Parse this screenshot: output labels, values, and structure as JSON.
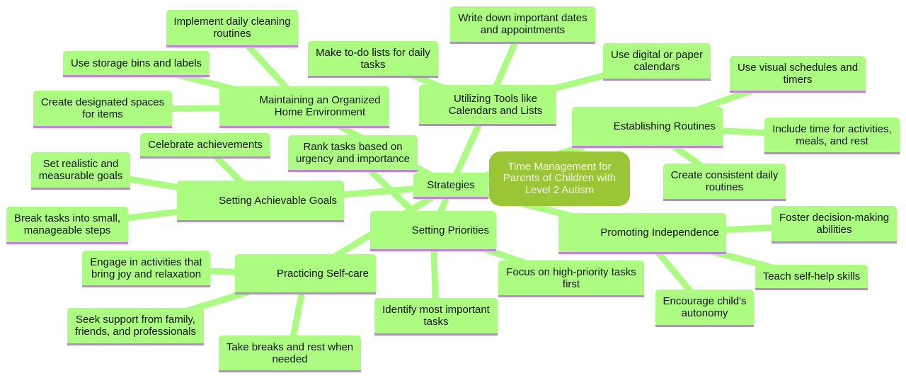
{
  "root": {
    "label": "Time Management for Parents of Children with Level 2 Autism"
  },
  "hub": {
    "label": "Strategies"
  },
  "colors": {
    "root_fill": "#9ac534",
    "node_fill": "#abfc80",
    "node_underline": "#c77fe8",
    "edge": "#a9fc80"
  },
  "branches": [
    {
      "label": "Maintaining an Organized Home Environment",
      "children": [
        "Implement daily cleaning routines",
        "Use storage bins and labels",
        "Create designated spaces for items"
      ]
    },
    {
      "label": "Utilizing Tools like Calendars and Lists",
      "children": [
        "Write down important dates and appointments",
        "Make to-do lists for daily tasks",
        "Use digital or paper calendars"
      ]
    },
    {
      "label": "Establishing Routines",
      "children": [
        "Use visual schedules and timers",
        "Include time for activities, meals, and rest",
        "Create consistent daily routines"
      ]
    },
    {
      "label": "Setting Achievable Goals",
      "children": [
        "Celebrate achievements",
        "Set realistic and measurable goals",
        "Break tasks into small, manageable steps"
      ]
    },
    {
      "label": "Setting Priorities",
      "children": [
        "Rank tasks based on urgency and importance",
        "Focus on high-priority tasks first",
        "Identify most important tasks"
      ]
    },
    {
      "label": "Practicing Self-care",
      "children": [
        "Engage in activities that bring joy and relaxation",
        "Seek support from family, friends, and professionals",
        "Take breaks and rest when needed"
      ]
    },
    {
      "label": "Promoting Independence",
      "children": [
        "Foster decision-making abilities",
        "Teach self-help skills",
        "Encourage child's autonomy"
      ]
    }
  ]
}
